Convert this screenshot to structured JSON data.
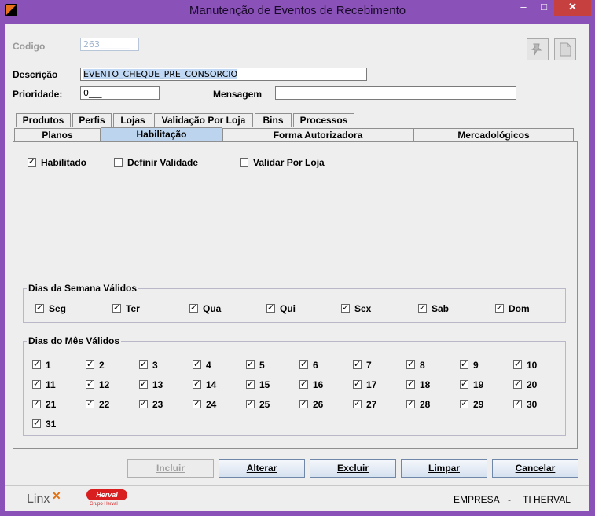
{
  "window": {
    "title": "Manutenção de Eventos de Recebimento",
    "min": "–",
    "max": "□",
    "close": "✕"
  },
  "form": {
    "codigo_label": "Codigo",
    "codigo_value": "263_______",
    "descricao_label": "Descrição",
    "descricao_value": "EVENTO_CHEQUE_PRE_CONSORCIO",
    "prioridade_label": "Prioridade:",
    "prioridade_value": "0___",
    "mensagem_label": "Mensagem",
    "mensagem_value": ""
  },
  "toolbar_icons": [
    "pin-icon",
    "document-icon"
  ],
  "tabs_row1": [
    "Produtos",
    "Perfis",
    "Lojas",
    "Validação Por Loja",
    "Bins",
    "Processos"
  ],
  "tabs_row2": [
    "Planos",
    "Habilitação",
    "Forma Autorizadora",
    "Mercadológicos"
  ],
  "active_tab": "Habilitação",
  "options": {
    "habilitado": {
      "label": "Habilitado",
      "checked": true
    },
    "definir_validade": {
      "label": "Definir Validade",
      "checked": false
    },
    "validar_por_loja": {
      "label": "Validar Por Loja",
      "checked": false
    }
  },
  "semana": {
    "title": "Dias da Semana Válidos",
    "days": [
      "Seg",
      "Ter",
      "Qua",
      "Qui",
      "Sex",
      "Sab",
      "Dom"
    ]
  },
  "mes": {
    "title": "Dias do Mês Válidos",
    "days": [
      "1",
      "2",
      "3",
      "4",
      "5",
      "6",
      "7",
      "8",
      "9",
      "10",
      "11",
      "12",
      "13",
      "14",
      "15",
      "16",
      "17",
      "18",
      "19",
      "20",
      "21",
      "22",
      "23",
      "24",
      "25",
      "26",
      "27",
      "28",
      "29",
      "30",
      "31"
    ]
  },
  "buttons": {
    "incluir": "Incluir",
    "alterar": "Alterar",
    "excluir": "Excluir",
    "limpar": "Limpar",
    "cancelar": "Cancelar"
  },
  "footer": {
    "linx_logo": "Linx",
    "herval_logo": "Herval",
    "herval_sub": "Grupo Herval",
    "empresa_label": "EMPRESA",
    "separator": "-",
    "empresa_value": "TI HERVAL"
  }
}
